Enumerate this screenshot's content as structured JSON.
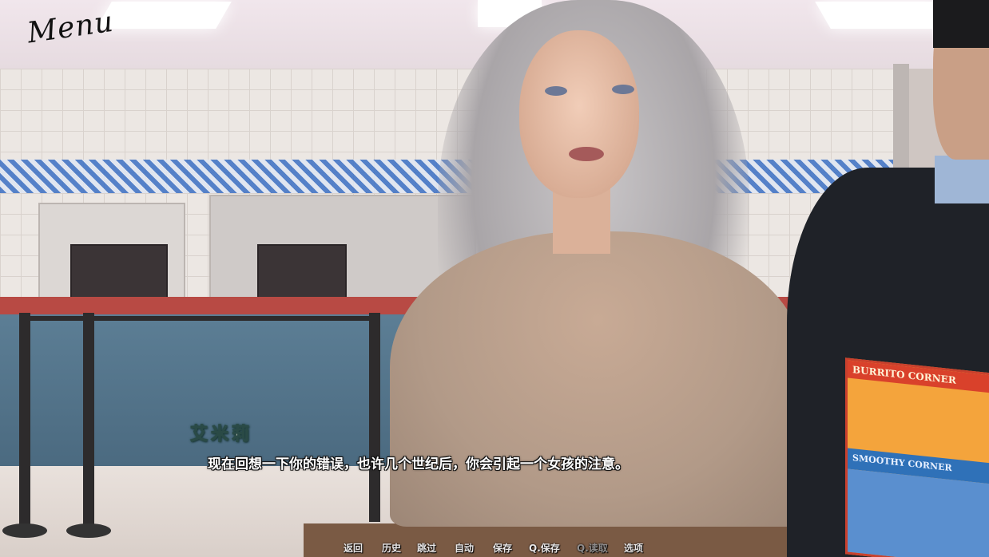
{
  "menu_label": "Menu",
  "speaker_name": "艾米莉",
  "dialogue_text": "现在回想一下你的错误，也许几个世纪后，你会引起一个女孩的注意。",
  "menu_card": {
    "top_label": "BURRITO CORNER",
    "middle_label": "SMOOTHY CORNER"
  },
  "quick_menu": {
    "back": "返回",
    "history": "历史",
    "skip": "跳过",
    "auto": "自动",
    "save": "保存",
    "quick_save": "Q.保存",
    "quick_load": "Q.读取",
    "options": "选项"
  }
}
